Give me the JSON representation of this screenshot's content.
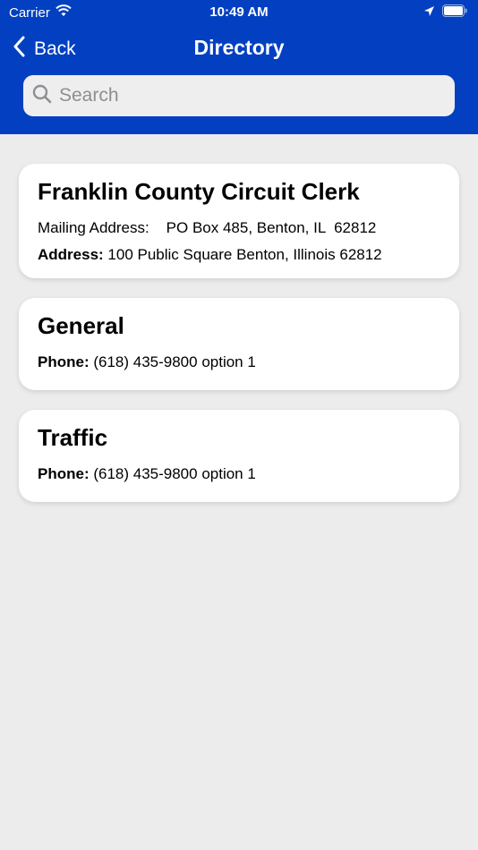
{
  "status_bar": {
    "carrier": "Carrier",
    "time": "10:49 AM"
  },
  "nav": {
    "back_label": "Back",
    "title": "Directory"
  },
  "search": {
    "placeholder": "Search"
  },
  "colors": {
    "header": "#0240c1",
    "background": "#ececec",
    "card": "#ffffff"
  },
  "cards": [
    {
      "title": "Franklin County Circuit Clerk",
      "mailing_label": "Mailing Address:",
      "mailing_value": "PO Box 485, Benton, IL  62812",
      "address_label": "Address:",
      "address_value": "100 Public Square Benton, Illinois 62812"
    },
    {
      "title": "General",
      "phone_label": "Phone:",
      "phone_value": "(618) 435-9800 option 1"
    },
    {
      "title": "Traffic",
      "phone_label": "Phone:",
      "phone_value": "(618) 435-9800 option 1"
    }
  ]
}
